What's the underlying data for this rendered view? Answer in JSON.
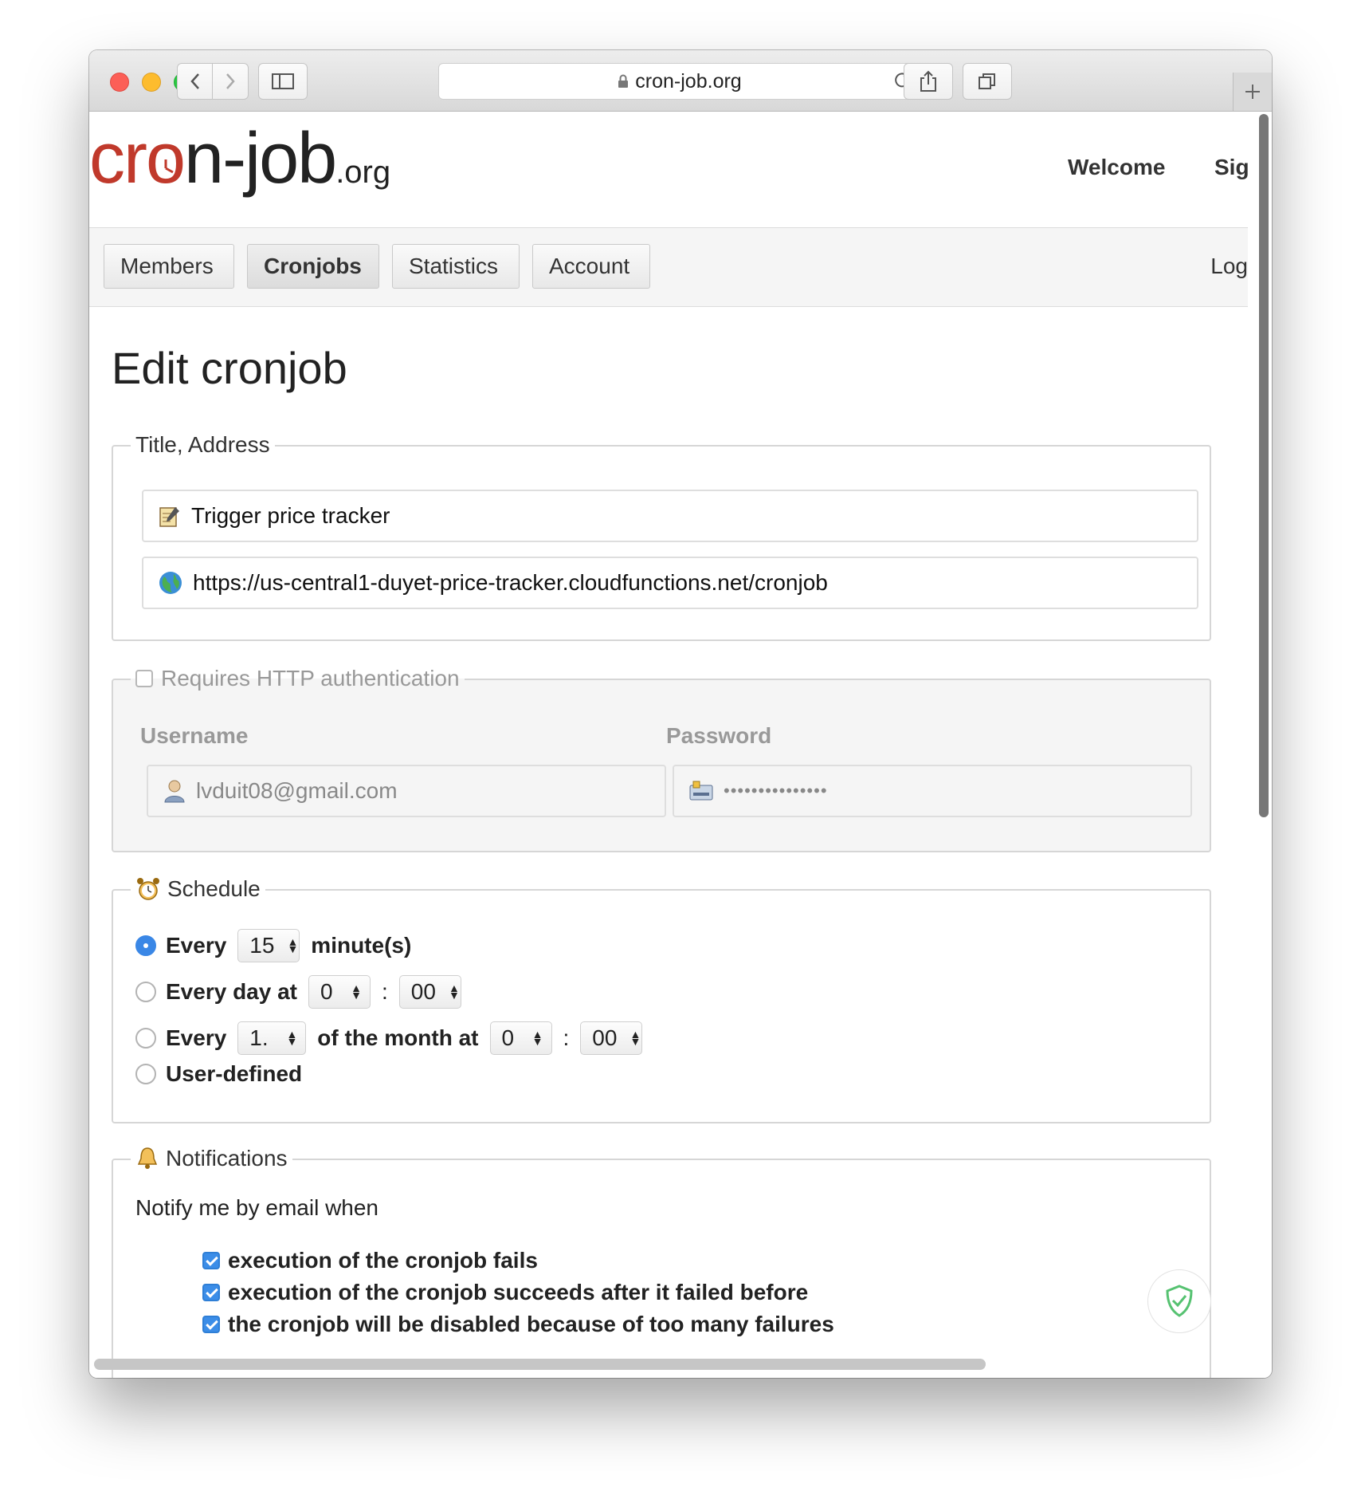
{
  "browser": {
    "url": "cron-job.org"
  },
  "header": {
    "logo_cr": "cr",
    "logo_o": "o",
    "logo_rest": "n-job",
    "logo_tld": ".org",
    "welcome": "Welcome",
    "signup": "Sig"
  },
  "nav": {
    "tabs": [
      {
        "label": "Members"
      },
      {
        "label": "Cronjobs"
      },
      {
        "label": "Statistics"
      },
      {
        "label": "Account"
      }
    ],
    "logout": "Log"
  },
  "page": {
    "title": "Edit cronjob"
  },
  "title_address": {
    "legend": "Title, Address",
    "title_value": "Trigger price tracker",
    "url_value": "https://us-central1-duyet-price-tracker.cloudfunctions.net/cronjob"
  },
  "auth": {
    "legend": "Requires HTTP authentication",
    "checked": false,
    "username_label": "Username",
    "password_label": "Password",
    "username_value": "lvduit08@gmail.com",
    "password_value": "•••••••••••••••"
  },
  "schedule": {
    "legend": "Schedule",
    "every_label": "Every",
    "every_value": "15",
    "minutes_label": "minute(s)",
    "every_day_label": "Every day at",
    "day_hour": "0",
    "day_minute": "00",
    "every_month_label": "Every",
    "month_day": "1.",
    "of_month_label": "of the month at",
    "month_hour": "0",
    "month_minute": "00",
    "colon": ":",
    "user_defined_label": "User-defined",
    "selected": "every"
  },
  "notifications": {
    "legend": "Notifications",
    "intro": "Notify me by email when",
    "options": [
      {
        "label": "execution of the cronjob fails",
        "checked": true
      },
      {
        "label": "execution of the cronjob succeeds after it failed before",
        "checked": true
      },
      {
        "label": "the cronjob will be disabled because of too many failures",
        "checked": true
      }
    ]
  },
  "colors": {
    "brand_red": "#c0392b",
    "accent_blue": "#3b8de8"
  }
}
